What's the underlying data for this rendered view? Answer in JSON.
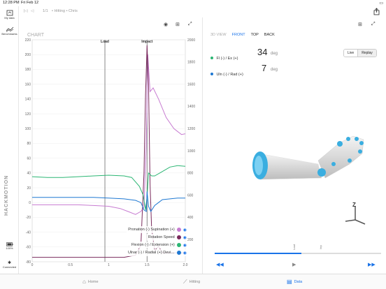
{
  "status": {
    "time": "12:28 PM",
    "date": "Fri Feb 12"
  },
  "nav": {
    "breadcrumb_count": "1/1",
    "breadcrumb_trail": "• Hitting • Chris"
  },
  "sidebar": {
    "my_data_label": "My data",
    "benchmarks_label": "Benchmarks",
    "brand": "HACKMOTION",
    "battery_label": "100%",
    "connection_label": "Connected"
  },
  "chart_panel": {
    "title": "CHART"
  },
  "chart_data": {
    "type": "line",
    "x_range": [
      0,
      2.0
    ],
    "x_ticks": [
      "0",
      "0.5",
      "1",
      "1.5",
      "2.0"
    ],
    "y_left_range": [
      -80,
      220
    ],
    "y_left_ticks": [
      "220",
      "200",
      "180",
      "160",
      "140",
      "120",
      "100",
      "80",
      "60",
      "40",
      "20",
      "0",
      "-20",
      "-40",
      "-60",
      "-80"
    ],
    "y_right_range": [
      0,
      2000
    ],
    "y_right_ticks": [
      "2000",
      "1800",
      "1600",
      "1400",
      "1200",
      "1000",
      "800",
      "600",
      "400",
      "200"
    ],
    "markers": [
      {
        "label": "Load",
        "x": 0.95
      },
      {
        "label": "Impact",
        "x": 1.5
      }
    ],
    "series": [
      {
        "name": "Pronation (-) Supination (+)",
        "color": "#c77bd1",
        "axis": "left",
        "points": [
          [
            0,
            -3
          ],
          [
            0.2,
            -3
          ],
          [
            0.4,
            -3
          ],
          [
            0.6,
            -3
          ],
          [
            0.8,
            -4
          ],
          [
            1.0,
            -5
          ],
          [
            1.15,
            -8
          ],
          [
            1.25,
            -12
          ],
          [
            1.35,
            -16
          ],
          [
            1.42,
            -12
          ],
          [
            1.46,
            -6
          ],
          [
            1.49,
            80
          ],
          [
            1.51,
            200
          ],
          [
            1.54,
            150
          ],
          [
            1.58,
            155
          ],
          [
            1.65,
            140
          ],
          [
            1.75,
            115
          ],
          [
            1.85,
            100
          ],
          [
            1.95,
            92
          ],
          [
            2.0,
            93
          ]
        ]
      },
      {
        "name": "Rotation Speed",
        "color": "#7a2a5c",
        "axis": "right",
        "points": [
          [
            0,
            40
          ],
          [
            0.5,
            40
          ],
          [
            1.0,
            40
          ],
          [
            1.2,
            40
          ],
          [
            1.35,
            60
          ],
          [
            1.42,
            150
          ],
          [
            1.46,
            800
          ],
          [
            1.48,
            1500
          ],
          [
            1.5,
            1950
          ],
          [
            1.52,
            1600
          ],
          [
            1.54,
            700
          ],
          [
            1.56,
            300
          ],
          [
            1.6,
            100
          ],
          [
            1.65,
            140
          ],
          [
            1.7,
            80
          ],
          [
            2.0,
            80
          ]
        ]
      },
      {
        "name": "Flexion (-) / Extension (+)",
        "color": "#2bb673",
        "axis": "left",
        "points": [
          [
            0,
            35
          ],
          [
            0.2,
            34
          ],
          [
            0.4,
            34
          ],
          [
            0.6,
            35
          ],
          [
            0.8,
            36
          ],
          [
            1.0,
            37
          ],
          [
            1.2,
            36
          ],
          [
            1.3,
            34
          ],
          [
            1.4,
            22
          ],
          [
            1.45,
            10
          ],
          [
            1.48,
            -10
          ],
          [
            1.5,
            8
          ],
          [
            1.52,
            40
          ],
          [
            1.56,
            36
          ],
          [
            1.6,
            36
          ],
          [
            1.7,
            42
          ],
          [
            1.8,
            48
          ],
          [
            1.9,
            50
          ],
          [
            2.0,
            49
          ]
        ]
      },
      {
        "name": "Ulnar (-) / Radial (+) Devi…",
        "color": "#1e78d2",
        "axis": "left",
        "points": [
          [
            0,
            7
          ],
          [
            0.2,
            7
          ],
          [
            0.4,
            7
          ],
          [
            0.6,
            7
          ],
          [
            0.8,
            7
          ],
          [
            1.0,
            6
          ],
          [
            1.2,
            5
          ],
          [
            1.35,
            3
          ],
          [
            1.42,
            0
          ],
          [
            1.46,
            -10
          ],
          [
            1.49,
            -12
          ],
          [
            1.5,
            15
          ],
          [
            1.52,
            -5
          ],
          [
            1.55,
            -12
          ],
          [
            1.6,
            -4
          ],
          [
            1.65,
            0
          ],
          [
            1.7,
            4
          ],
          [
            1.8,
            5
          ],
          [
            1.9,
            6
          ],
          [
            2.0,
            6
          ]
        ]
      }
    ]
  },
  "view3d": {
    "label": "3D VIEW",
    "views": [
      "FRONT",
      "TOP",
      "BACK"
    ],
    "active_view": "FRONT",
    "readouts": [
      {
        "label": "Fl (-) / Ex (+)",
        "value": "34",
        "unit": "deg",
        "color": "#2bb673"
      },
      {
        "label": "Uln (-) / Rad (+)",
        "value": "7",
        "unit": "deg",
        "color": "#1e78d2"
      }
    ],
    "live_label": "Live",
    "replay_label": "Replay",
    "axis_letter": "Z",
    "scrubber_progress": 0.52,
    "scrubber_markers": [
      "Load",
      "Imp"
    ]
  },
  "tabbar": {
    "home": "Home",
    "hitting": "Hitting",
    "data": "Data"
  },
  "colors": {
    "accent": "#1a73e8",
    "grey": "#9a9a9a"
  }
}
